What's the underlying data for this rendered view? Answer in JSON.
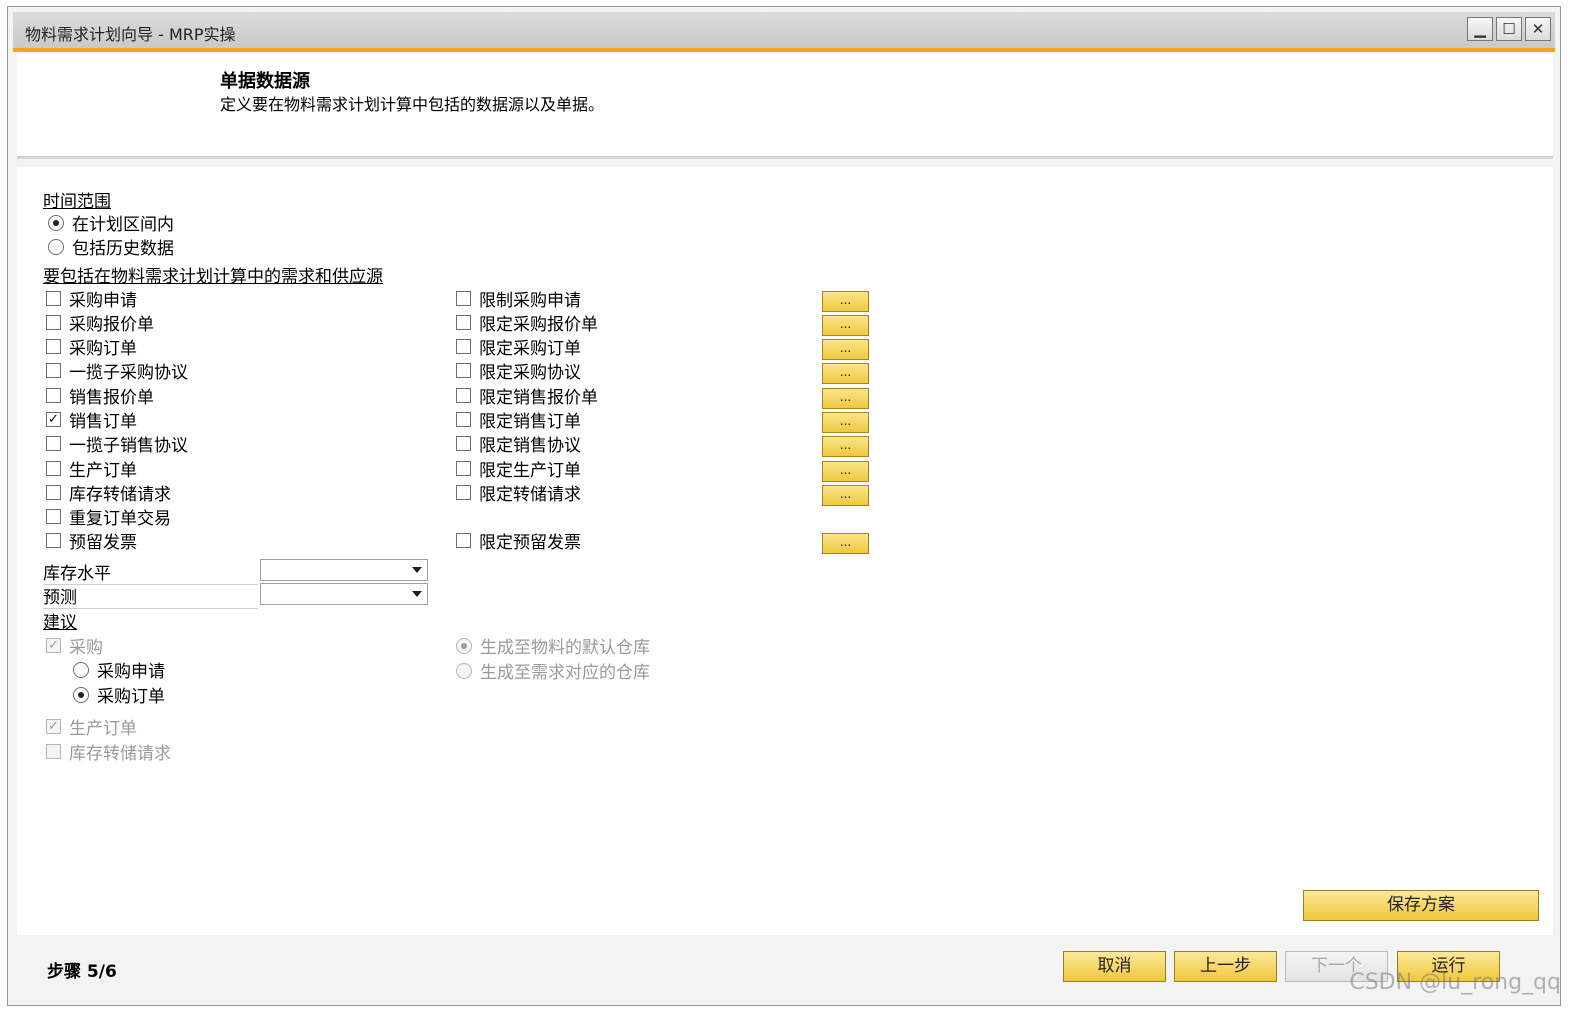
{
  "window": {
    "title": "物料需求计划向导 - MRP实操",
    "min_symbol": "▁",
    "max_symbol": "☐",
    "close_symbol": "✕"
  },
  "header": {
    "title": "单据数据源",
    "description": "定义要在物料需求计划计算中包括的数据源以及单据。"
  },
  "time_range": {
    "label": "时间范围",
    "options": [
      {
        "label": "在计划区间内",
        "selected": true
      },
      {
        "label": "包括历史数据",
        "selected": false
      }
    ]
  },
  "sources": {
    "label": "要包括在物料需求计划计算中的需求和供应源",
    "left": [
      {
        "label": "采购申请",
        "checked": false
      },
      {
        "label": "采购报价单",
        "checked": false
      },
      {
        "label": "采购订单",
        "checked": false
      },
      {
        "label": "一揽子采购协议",
        "checked": false
      },
      {
        "label": "销售报价单",
        "checked": false
      },
      {
        "label": "销售订单",
        "checked": true
      },
      {
        "label": "一揽子销售协议",
        "checked": false
      },
      {
        "label": "生产订单",
        "checked": false
      },
      {
        "label": "库存转储请求",
        "checked": false
      },
      {
        "label": "重复订单交易",
        "checked": false
      },
      {
        "label": "预留发票",
        "checked": false
      }
    ],
    "right": [
      {
        "label": "限制采购申请",
        "checked": false
      },
      {
        "label": "限定采购报价单",
        "checked": false
      },
      {
        "label": "限定采购订单",
        "checked": false
      },
      {
        "label": "限定采购协议",
        "checked": false
      },
      {
        "label": "限定销售报价单",
        "checked": false
      },
      {
        "label": "限定销售订单",
        "checked": false
      },
      {
        "label": "限定销售协议",
        "checked": false
      },
      {
        "label": "限定生产订单",
        "checked": false
      },
      {
        "label": "限定转储请求",
        "checked": false
      },
      {
        "label": "限定预留发票",
        "checked": false
      }
    ],
    "dots_label": "..."
  },
  "fields": {
    "stock_level": {
      "label": "库存水平",
      "value": ""
    },
    "forecast": {
      "label": "预测",
      "value": ""
    }
  },
  "suggestion": {
    "label": "建议",
    "purchase": {
      "label": "采购",
      "checked": true
    },
    "purchase_options": [
      {
        "label": "采购申请",
        "selected": false
      },
      {
        "label": "采购订单",
        "selected": true
      }
    ],
    "warehouse_options": [
      {
        "label": "生成至物料的默认仓库",
        "selected": true
      },
      {
        "label": "生成至需求对应的仓库",
        "selected": false
      }
    ],
    "production": {
      "label": "生产订单",
      "checked": true
    },
    "transfer": {
      "label": "库存转储请求",
      "checked": false
    }
  },
  "save_button": "保存方案",
  "footer": {
    "step": "步骤 5/6",
    "cancel": "取消",
    "back": "上一步",
    "next": "下一个",
    "run": "运行"
  },
  "watermark": "CSDN @lu_rong_qq",
  "colors": {
    "accent": "#f0a818",
    "button": "#f1c73c"
  }
}
